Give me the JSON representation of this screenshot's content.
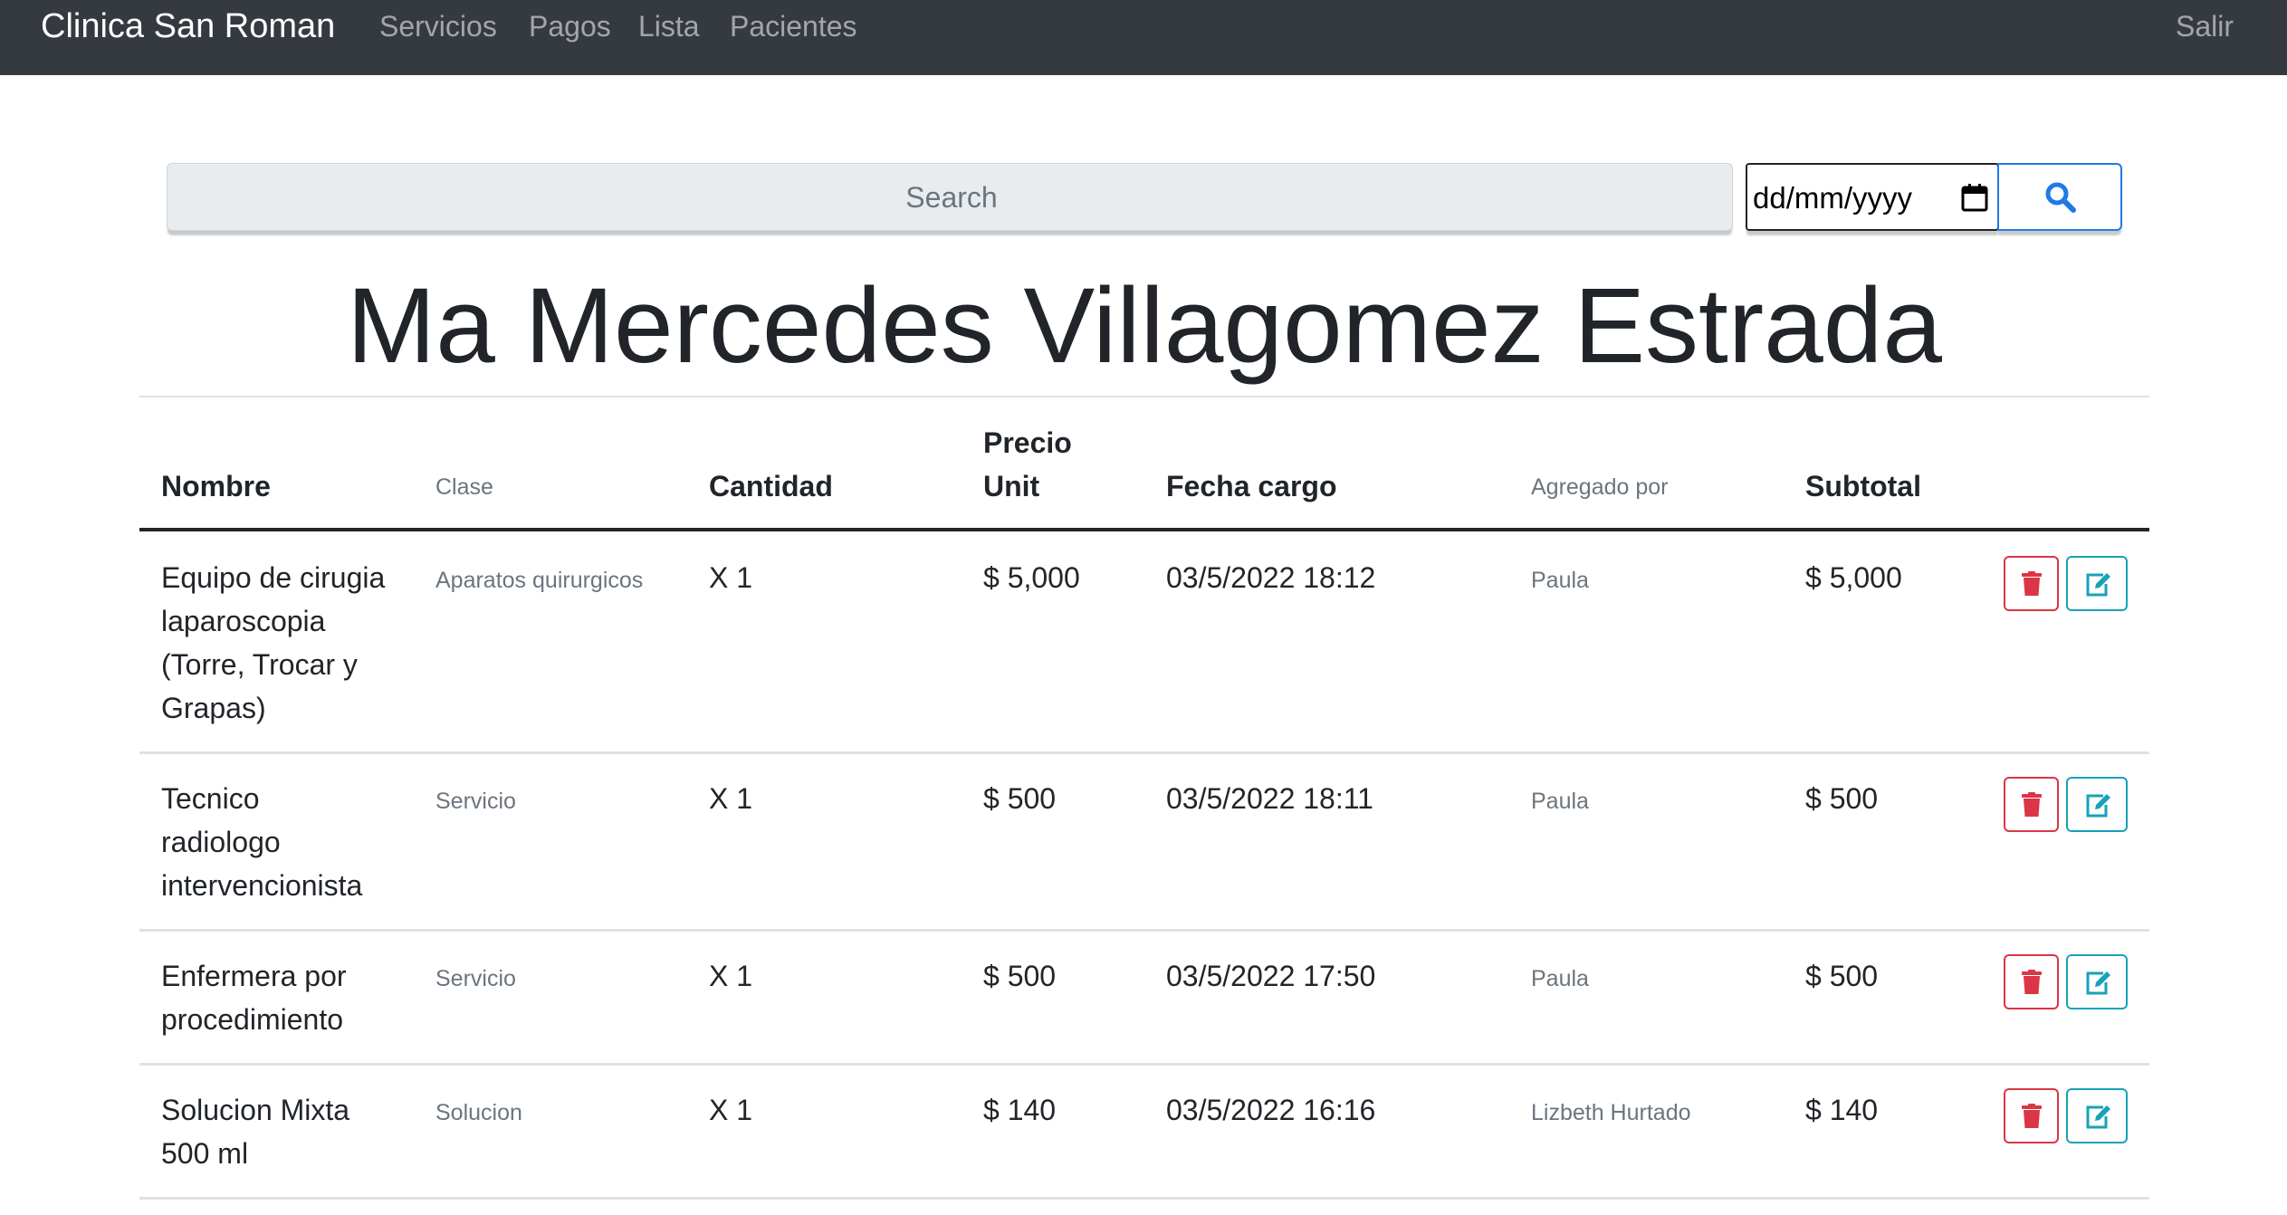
{
  "navbar": {
    "brand": "Clinica San Roman",
    "links": [
      "Servicios",
      "Pagos",
      "Lista",
      "Pacientes"
    ],
    "logout": "Salir"
  },
  "search": {
    "placeholder": "Search",
    "date_placeholder": "dd/mm/yyyy",
    "button_icon": "search-icon"
  },
  "patient": {
    "name": "Ma Mercedes Villagomez Estrada"
  },
  "table": {
    "headers": {
      "nombre": "Nombre",
      "clase": "Clase",
      "cantidad": "Cantidad",
      "precio_line1": "Precio",
      "precio_line2": "Unit",
      "fecha": "Fecha cargo",
      "agregado": "Agregado por",
      "subtotal": "Subtotal"
    },
    "rows": [
      {
        "nombre_lines": [
          "Equipo de cirugia",
          "laparoscopia",
          "(Torre, Trocar y",
          "Grapas)"
        ],
        "clase": "Aparatos quirurgicos",
        "cantidad": "X 1",
        "precio": "$ 5,000",
        "fecha": "03/5/2022 18:12",
        "agregado": "Paula",
        "subtotal": "$ 5,000"
      },
      {
        "nombre_lines": [
          "Tecnico",
          "radiologo",
          "intervencionista"
        ],
        "clase": "Servicio",
        "cantidad": "X 1",
        "precio": "$ 500",
        "fecha": "03/5/2022 18:11",
        "agregado": "Paula",
        "subtotal": "$ 500"
      },
      {
        "nombre_lines": [
          "Enfermera por",
          "procedimiento"
        ],
        "clase": "Servicio",
        "cantidad": "X 1",
        "precio": "$ 500",
        "fecha": "03/5/2022 17:50",
        "agregado": "Paula",
        "subtotal": "$ 500"
      },
      {
        "nombre_lines": [
          "Solucion Mixta",
          "500 ml"
        ],
        "clase": "Solucion",
        "cantidad": "X 1",
        "precio": "$ 140",
        "fecha": "03/5/2022 16:16",
        "agregado": "Lizbeth Hurtado",
        "subtotal": "$ 140"
      }
    ],
    "row_actions": {
      "delete_icon": "trash-icon",
      "edit_icon": "edit-icon"
    }
  },
  "colors": {
    "navbar_bg": "#343a40",
    "danger": "#dc3545",
    "info": "#17a2b8",
    "primary": "#1f7ae6"
  }
}
